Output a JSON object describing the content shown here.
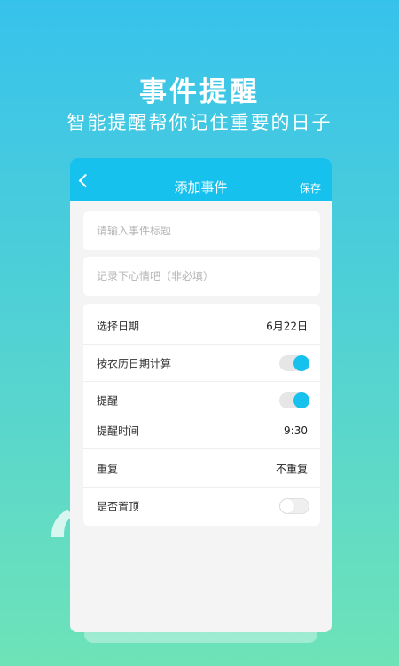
{
  "hero": {
    "title": "事件提醒",
    "subtitle": "智能提醒帮你记住重要的日子"
  },
  "nav": {
    "title": "添加事件",
    "save_label": "保存"
  },
  "form": {
    "title_placeholder": "请输入事件标题",
    "mood_placeholder": "记录下心情吧（非必填）"
  },
  "settings": {
    "date_label": "选择日期",
    "date_value": "6月22日",
    "lunar_label": "按农历日期计算",
    "lunar_on": true,
    "remind_label": "提醒",
    "remind_on": true,
    "remind_time_label": "提醒时间",
    "remind_time_value": "9:30",
    "repeat_label": "重复",
    "repeat_value": "不重复",
    "pin_label": "是否置顶",
    "pin_on": false
  },
  "colors": {
    "accent": "#16c1ee",
    "gradient_top": "#37c2ec",
    "gradient_bottom": "#6ee3b8"
  }
}
